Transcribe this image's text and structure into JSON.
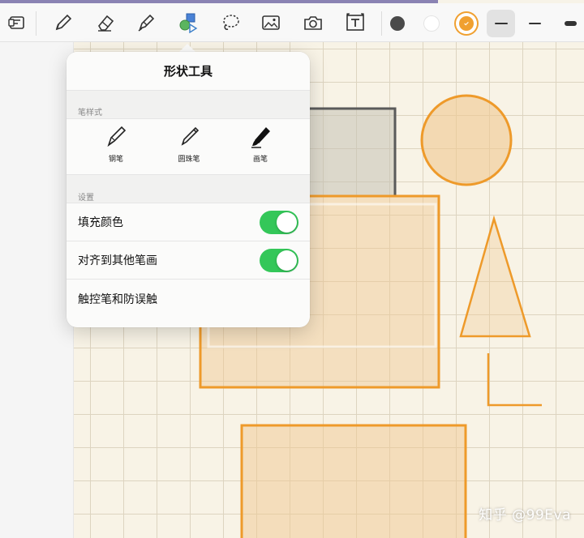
{
  "toolbar": {
    "tools": [
      {
        "icon": "document-icon"
      },
      {
        "icon": "pen-icon"
      },
      {
        "icon": "eraser-icon"
      },
      {
        "icon": "highlighter-icon"
      },
      {
        "icon": "shapes-icon",
        "selected": true
      },
      {
        "icon": "lasso-icon"
      },
      {
        "icon": "image-icon"
      },
      {
        "icon": "camera-icon"
      },
      {
        "icon": "text-icon"
      }
    ],
    "colors": [
      {
        "name": "dark-gray",
        "hex": "#4a4a4a"
      },
      {
        "name": "white",
        "hex": "#ffffff"
      },
      {
        "name": "orange",
        "hex": "#f0a030",
        "selected": true
      }
    ],
    "widths": [
      "thin",
      "medium",
      "thick"
    ]
  },
  "popover": {
    "title": "形状工具",
    "pen_style_label": "笔样式",
    "pens": [
      {
        "label": "钢笔",
        "icon": "fountain-pen-icon"
      },
      {
        "label": "圆珠笔",
        "icon": "ballpoint-pen-icon"
      },
      {
        "label": "画笔",
        "icon": "brush-pen-icon"
      }
    ],
    "settings_label": "设置",
    "settings": [
      {
        "label": "填充颜色",
        "toggle": true
      },
      {
        "label": "对齐到其他笔画",
        "toggle": true
      },
      {
        "label": "触控笔和防误触"
      }
    ]
  },
  "watermark": "知乎 @99Eva",
  "colors": {
    "accent_orange": "#f0a030",
    "toggle_green": "#34c759",
    "canvas_bg": "#f8f3e6"
  }
}
